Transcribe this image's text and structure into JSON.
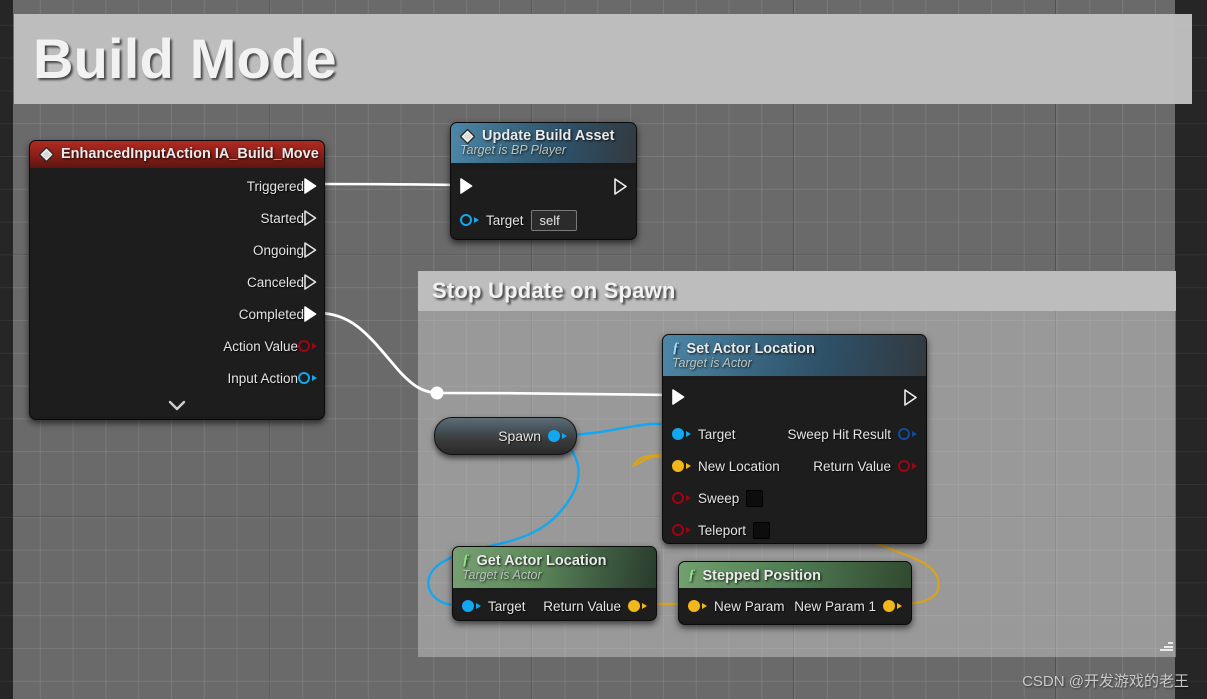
{
  "canvas": {
    "watermark": "CSDN @开发游戏的老王"
  },
  "comments": [
    {
      "id": "build",
      "title": "Build Mode"
    },
    {
      "id": "spawn",
      "title": "Stop Update on Spawn"
    }
  ],
  "nodes": {
    "enhanced_input": {
      "title": "EnhancedInputAction IA_Build_Move",
      "icon": "diamond-icon",
      "outputs": [
        {
          "label": "Triggered",
          "type": "exec",
          "connected": true
        },
        {
          "label": "Started",
          "type": "exec",
          "connected": false
        },
        {
          "label": "Ongoing",
          "type": "exec",
          "connected": false
        },
        {
          "label": "Canceled",
          "type": "exec",
          "connected": false
        },
        {
          "label": "Completed",
          "type": "exec",
          "connected": true
        },
        {
          "label": "Action Value",
          "type": "data",
          "color": "#9e0511"
        },
        {
          "label": "Input Action",
          "type": "data",
          "color": "#12a7f0"
        }
      ],
      "expand_icon": "chevron-down-icon"
    },
    "update_build_asset": {
      "title": "Update Build Asset",
      "subtitle": "Target is BP Player",
      "icon": "diamond-icon",
      "exec_in": "",
      "exec_out": "",
      "inputs": [
        {
          "label": "Target",
          "value": "self",
          "color": "#12a7f0"
        }
      ]
    },
    "spawn": {
      "label": "Spawn",
      "pin_color": "#12a7f0"
    },
    "set_actor_location": {
      "title": "Set Actor Location",
      "subtitle": "Target is Actor",
      "icon": "function-f-icon",
      "inputs": [
        {
          "label": "Target",
          "color": "#12a7f0",
          "style": "fill"
        },
        {
          "label": "New Location",
          "color": "#f2b71a",
          "style": "fill"
        },
        {
          "label": "Sweep",
          "color": "#9e0511",
          "style": "ring",
          "checkbox": true
        },
        {
          "label": "Teleport",
          "color": "#9e0511",
          "style": "ring",
          "checkbox": true
        }
      ],
      "outputs": [
        {
          "label": "Sweep Hit Result",
          "color": "#0f4d9c",
          "style": "ring"
        },
        {
          "label": "Return Value",
          "color": "#9e0511",
          "style": "ring"
        }
      ]
    },
    "get_actor_location": {
      "title": "Get Actor Location",
      "subtitle": "Target is Actor",
      "icon": "function-f-icon",
      "inputs": [
        {
          "label": "Target",
          "color": "#12a7f0"
        }
      ],
      "outputs": [
        {
          "label": "Return Value",
          "color": "#f2b71a"
        }
      ]
    },
    "stepped_position": {
      "title": "Stepped Position",
      "icon": "function-f-icon",
      "inputs": [
        {
          "label": "New Param",
          "color": "#f2b71a"
        }
      ],
      "outputs": [
        {
          "label": "New Param 1",
          "color": "#f2b71a"
        }
      ]
    }
  },
  "colors": {
    "exec_wire": "#ffffff",
    "data_blue": "#12a7f0",
    "data_yellow": "#f2b71a",
    "data_red": "#9e0511",
    "header_red": "#8a1f18",
    "header_blue": "#37627c",
    "header_green": "#5f8a5c",
    "canvas_bg": "#6a6a6a"
  }
}
